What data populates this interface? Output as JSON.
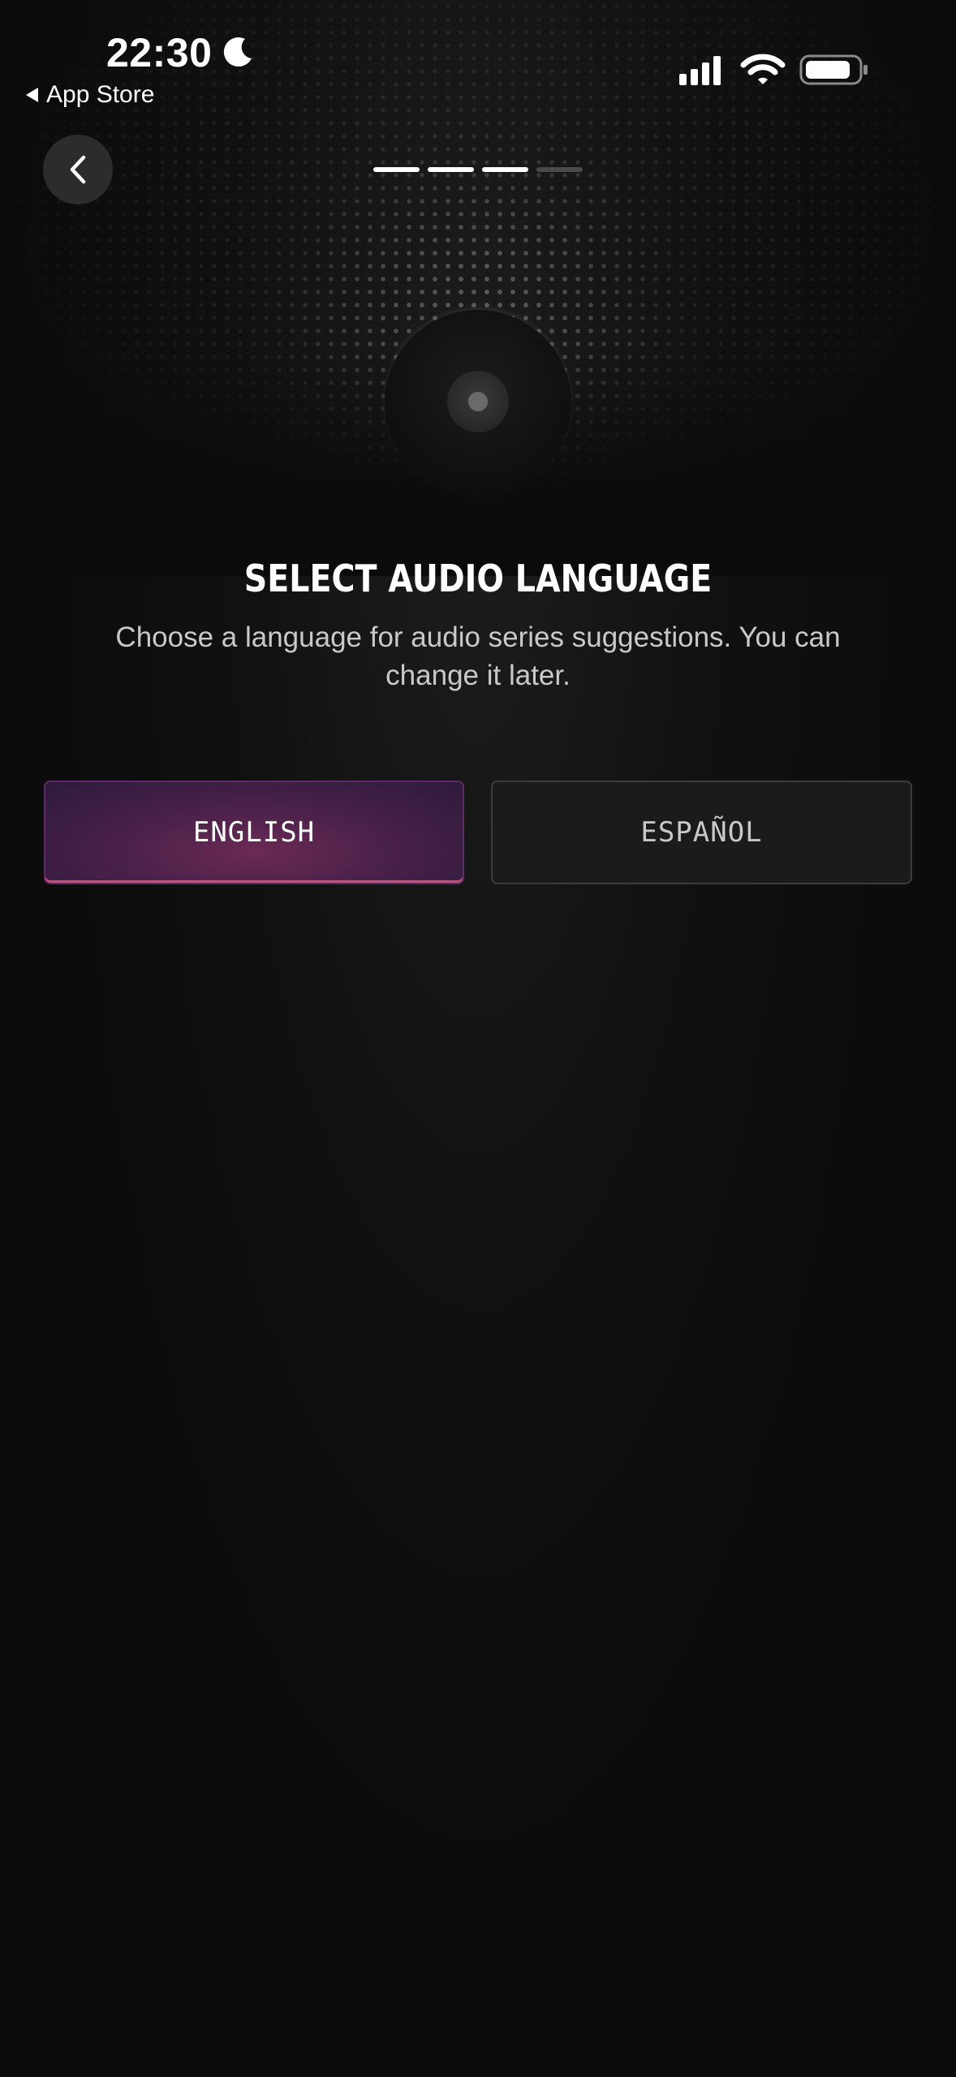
{
  "status_bar": {
    "time": "22:30",
    "back_app_label": "App Store",
    "icons": [
      "moon-icon",
      "cellular-signal-icon",
      "wifi-icon",
      "battery-icon"
    ]
  },
  "nav": {
    "back_icon": "chevron-left-icon",
    "progress": {
      "total_steps": 4,
      "completed_steps": 3
    }
  },
  "header": {
    "title": "SELECT AUDIO LANGUAGE",
    "subtitle": "Choose a language for audio series suggestions. You can change it later."
  },
  "languages": [
    {
      "label": "ENGLISH",
      "selected": true
    },
    {
      "label": "ESPAÑOL",
      "selected": false
    }
  ],
  "colors": {
    "background": "#0b0b0b",
    "selected_accent": "#6b2a55",
    "selected_underline": "#e65078",
    "unselected_bg": "#1b1b1b"
  }
}
